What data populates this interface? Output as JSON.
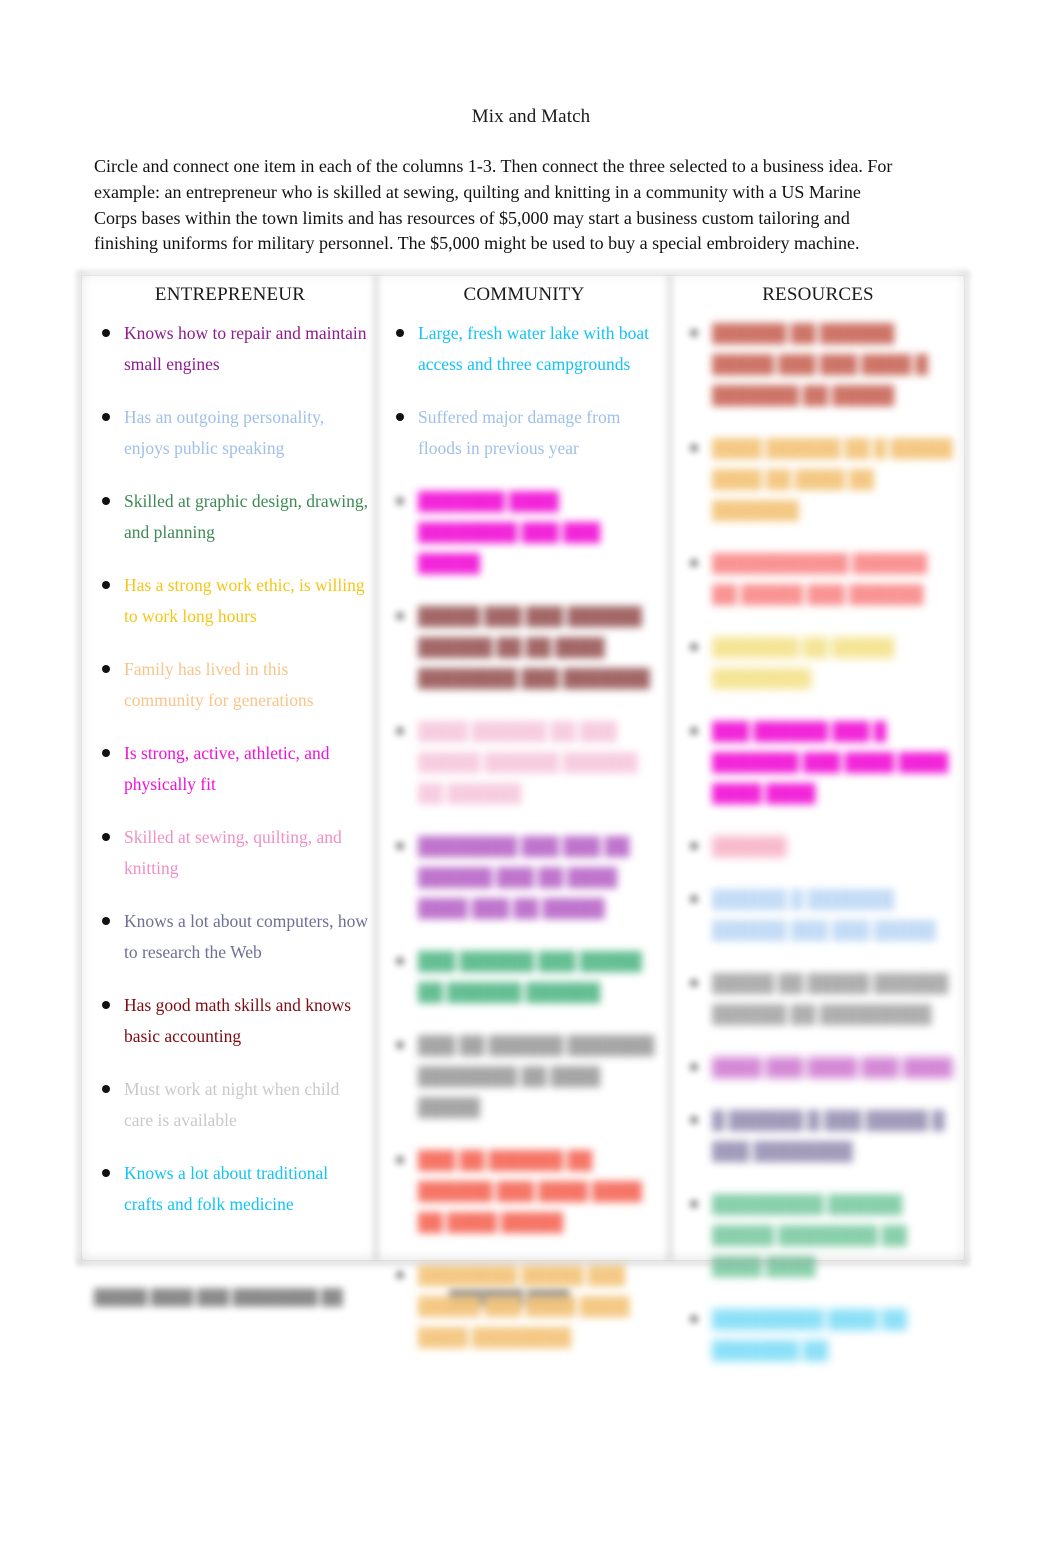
{
  "document": {
    "title": "Mix and Match",
    "intro": "Circle and connect one item in each of the columns 1-3. Then connect the three selected to a business idea. For example: an entrepreneur who is skilled at sewing, quilting and knitting in a community with a US Marine Corps bases within the town limits and has resources of $5,000 may start a business custom tailoring and finishing uniforms for military personnel. The $5,000 might be used to buy a special embroidery machine."
  },
  "table": {
    "columns": [
      {
        "header": "ENTREPRENEUR",
        "items": [
          {
            "text": "Knows how to repair and maintain small engines",
            "color": "#8E1B8E",
            "legible": true
          },
          {
            "text": "Has an outgoing personality, enjoys public speaking",
            "color": "#9FC0E8",
            "legible": true
          },
          {
            "text": "Skilled at graphic design, drawing, and planning",
            "color": "#3E8A55",
            "legible": true
          },
          {
            "text": "Has a strong work ethic, is willing to work long hours",
            "color": "#F5C518",
            "legible": true
          },
          {
            "text": "Family has lived in this community for generations",
            "color": "#F7C48A",
            "legible": true
          },
          {
            "text": "Is strong, active, athletic, and physically fit",
            "color": "#F112D6",
            "legible": true
          },
          {
            "text": "Skilled at sewing, quilting, and knitting",
            "color": "#F08FC3",
            "legible": true
          },
          {
            "text": "Knows a lot about computers, how to research the Web",
            "color": "#6E6E96",
            "legible": true
          },
          {
            "text": "Has good math skills and knows basic accounting",
            "color": "#7E0B12",
            "legible": true
          },
          {
            "text": "Must work at night when child care is available",
            "color": "#C9C9C9",
            "legible": true
          },
          {
            "text": "Knows a lot about traditional crafts and folk medicine",
            "color": "#14C3F5",
            "legible": true
          }
        ]
      },
      {
        "header": "COMMUNITY",
        "items": [
          {
            "text": "Large, fresh water lake with boat access and three campgrounds",
            "color": "#14C3F5",
            "legible": true
          },
          {
            "text": "Suffered major damage from floods in previous year",
            "color": "#9FC0E8",
            "legible": true
          },
          {
            "text": "███████ ████ ████████ ███ ███ █████",
            "color": "#F112D6",
            "legible": false,
            "lines": 2
          },
          {
            "text": "█████ ███ ███ ██████ ██████ ██ ██ ████ ████████ ███ ███████",
            "color": "#9A5A5A",
            "legible": false,
            "lines": 3
          },
          {
            "text": "████ ██████ ██ ███ █████ ██████ ██████ ██ ██████",
            "color": "#F6C9DD",
            "legible": false,
            "lines": 2
          },
          {
            "text": "████████ ███ ███ ██ ██████ ███ ██ ████ ████ ███ ██ █████",
            "color": "#B968C8",
            "legible": false,
            "lines": 3
          },
          {
            "text": "███ ██████ ███ █████ ██ ██████ ██████",
            "color": "#57B98A",
            "legible": false,
            "lines": 2
          },
          {
            "text": "███ ██ ██████ ███████ ████████ ██ ████ █████",
            "color": "#9E9E9E",
            "legible": false,
            "lines": 2
          },
          {
            "text": "███ ██ ██████ ██ ██████ ███ ████ ████ ██ ████ █████",
            "color": "#F56A5A",
            "legible": false,
            "lines": 3
          },
          {
            "text": "████████ █████ ███ █████ ███ ████ ████ ████ ████████",
            "color": "#F3C47A",
            "legible": false,
            "lines": 2
          }
        ]
      },
      {
        "header": "RESOURCES",
        "items": [
          {
            "text": "██████ ██ ██████ █████ ███ ███ ████ █ ███████ ██ █████",
            "color": "#C9685A",
            "legible": false,
            "lines": 3
          },
          {
            "text": "████ ██████ ██ █ █████ ████ ██ ████ ██ ███████",
            "color": "#F3C47A",
            "legible": false,
            "lines": 2
          },
          {
            "text": "███████████ ██████ ██ █████ ███ ██████",
            "color": "#F98A8A",
            "legible": false,
            "lines": 2
          },
          {
            "text": "███████ ██ █████ ████████",
            "color": "#F2DE7A",
            "legible": false,
            "lines": 1
          },
          {
            "text": "███ ██████ ███ █ ███████ ███ ████ ████ ████ ████",
            "color": "#F112D6",
            "legible": false,
            "lines": 2
          },
          {
            "text": "██████",
            "color": "#F6A8C0",
            "legible": false,
            "lines": 1
          },
          {
            "text": "██████ █ ███████ ██████ ███ ███ █████",
            "color": "#BFD9F5",
            "legible": false,
            "lines": 2
          },
          {
            "text": "█████ ██ █████ ██████ ██████ ██ █████████",
            "color": "#A8A8A8",
            "legible": false,
            "lines": 2
          },
          {
            "text": "████ ███ ████ ███ ████",
            "color": "#C96ACB",
            "legible": false,
            "lines": 1
          },
          {
            "text": "█ ██████ █ ███ █████ █ ███ ████████",
            "color": "#9A93B5",
            "legible": false,
            "lines": 2
          },
          {
            "text": "█████████ ██████ █████ ████████ ██ ████ ████",
            "color": "#7ECBA4",
            "legible": false,
            "lines": 2
          },
          {
            "text": "█████████ ████ ██ ███████ ██",
            "color": "#6FD8F5",
            "legible": false,
            "lines": 1
          }
        ]
      }
    ]
  },
  "footer": {
    "left": "█████ ████ ███ ████████ ██",
    "right": "███████ ████"
  }
}
